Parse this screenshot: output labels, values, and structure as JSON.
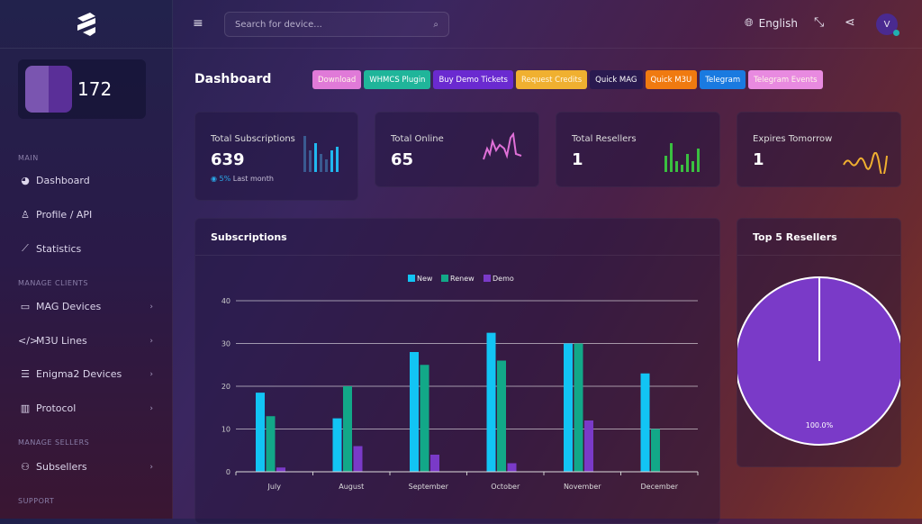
{
  "sidebar": {
    "balance": "172",
    "sections": [
      "MAIN",
      "MANAGE CLIENTS",
      "MANAGE SELLERS",
      "SUPPORT"
    ],
    "items": [
      {
        "label": "Dashboard",
        "icon": "gauge-icon"
      },
      {
        "label": "Profile / API",
        "icon": "user-icon"
      },
      {
        "label": "Statistics",
        "icon": "chart-line-icon"
      },
      {
        "label": "MAG Devices",
        "icon": "monitor-icon"
      },
      {
        "label": "M3U Lines",
        "icon": "code-icon"
      },
      {
        "label": "Enigma2 Devices",
        "icon": "server-icon"
      },
      {
        "label": "Protocol",
        "icon": "barcode-icon"
      },
      {
        "label": "Subsellers",
        "icon": "users-icon"
      }
    ]
  },
  "topbar": {
    "search_placeholder": "Search for device...",
    "language": "English",
    "user_initial": "V"
  },
  "page_title": "Dashboard",
  "buttons": [
    {
      "label": "Download",
      "color": "#e07ad8"
    },
    {
      "label": "WHMCS Plugin",
      "color": "#1fb59a"
    },
    {
      "label": "Buy Demo Tickets",
      "color": "#6a2ad0"
    },
    {
      "label": "Request Credits",
      "color": "#f0b030"
    },
    {
      "label": "Quick MAG",
      "color": "#2a1a50"
    },
    {
      "label": "Quick M3U",
      "color": "#f07a10"
    },
    {
      "label": "Telegram",
      "color": "#1a7ae0"
    },
    {
      "label": "Telegram Events",
      "color": "#e88ae0"
    }
  ],
  "stats": [
    {
      "title": "Total Subscriptions",
      "value": "639",
      "change": "5%",
      "change_label": "Last month"
    },
    {
      "title": "Total Online",
      "value": "65"
    },
    {
      "title": "Total Resellers",
      "value": "1"
    },
    {
      "title": "Expires Tomorrow",
      "value": "1"
    }
  ],
  "subscriptions_panel": {
    "title": "Subscriptions"
  },
  "resellers_panel": {
    "title": "Top 5 Resellers",
    "slice_label": "100.0%",
    "slice_value": 100,
    "slice_color": "#7a3ac8"
  },
  "chart_data": {
    "type": "bar",
    "categories": [
      "July",
      "August",
      "September",
      "October",
      "November",
      "December"
    ],
    "series": [
      {
        "name": "New",
        "color": "#12c4f4",
        "values": [
          18.5,
          12.5,
          28,
          32.5,
          30,
          23
        ]
      },
      {
        "name": "Renew",
        "color": "#12a888",
        "values": [
          13,
          20,
          25,
          26,
          30,
          10
        ]
      },
      {
        "name": "Demo",
        "color": "#7a3ac8",
        "values": [
          1,
          6,
          4,
          2,
          12,
          0
        ]
      }
    ],
    "ylim": [
      0,
      40
    ],
    "yticks": [
      0,
      10,
      20,
      30,
      40
    ],
    "legend": "top",
    "grid": true
  }
}
